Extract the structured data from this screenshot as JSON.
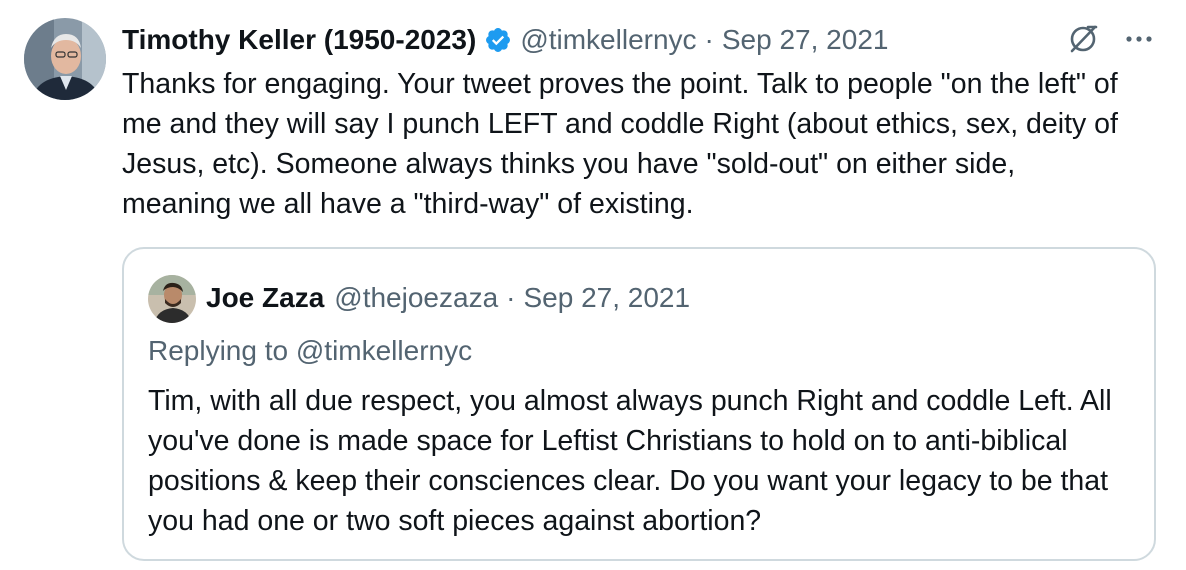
{
  "tweet": {
    "author_name": "Timothy Keller (1950-2023)",
    "handle": "@timkellernyc",
    "separator": "·",
    "date": "Sep 27, 2021",
    "text": "Thanks for engaging. Your tweet proves the point. Talk to people \"on the left\" of me and they will say I punch LEFT and coddle Right (about ethics, sex, deity of Jesus, etc). Someone always thinks you have \"sold-out\" on either side, meaning we all have a \"third-way\" of existing.",
    "more_label": "···"
  },
  "quoted": {
    "author_name": "Joe Zaza",
    "handle": "@thejoezaza",
    "separator": "·",
    "date": "Sep 27, 2021",
    "replying_to": "Replying to @timkellernyc",
    "text": "Tim, with all due respect, you almost always punch Right and coddle Left. All you've done is made space for Leftist Christians to hold on to anti-biblical positions & keep their consciences clear. Do you want your legacy to be that you had one or two soft pieces against abortion?"
  },
  "colors": {
    "text_primary": "#0f1419",
    "text_secondary": "#536471",
    "verified_blue": "#1d9bf0",
    "quote_border": "#cfd9de"
  },
  "icons": {
    "verified": "verified-badge-icon",
    "grok": "grok-icon",
    "more": "more-icon"
  }
}
